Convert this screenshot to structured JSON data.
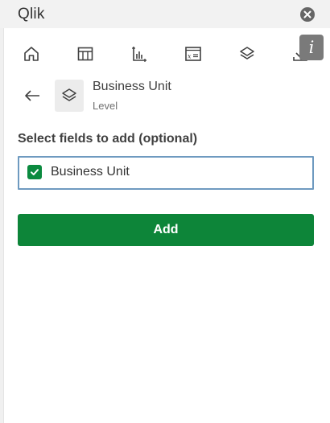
{
  "app": {
    "title": "Qlik"
  },
  "colors": {
    "accent_green": "#0d8539",
    "checkbox_green": "#0b8a3f",
    "focus_border": "#6e9ac0",
    "info_button": "#7a7a7a",
    "close_button": "#666666"
  },
  "toolbar": {
    "icons": [
      "home-icon",
      "table-icon",
      "bar-chart-icon",
      "formula-icon",
      "layers-icon",
      "download-icon",
      "info-icon"
    ],
    "info_label": "i"
  },
  "item": {
    "name": "Business Unit",
    "type": "Level",
    "icon": "layers-icon"
  },
  "fields": {
    "label": "Select fields to add (optional)",
    "items": [
      {
        "label": "Business Unit",
        "checked": true
      }
    ]
  },
  "actions": {
    "add_label": "Add"
  }
}
